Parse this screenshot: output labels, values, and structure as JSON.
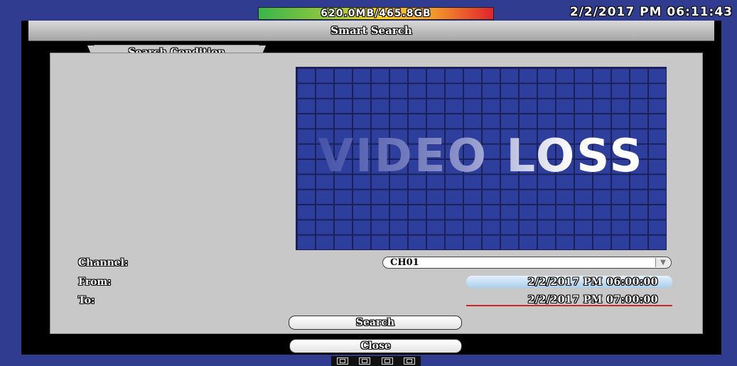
{
  "status_bar": {
    "storage": "620.0MB/465.8GB",
    "datetime": "2/2/2017 PM 06:11:43"
  },
  "window": {
    "title": "Smart Search",
    "tab_label": "Search Condition"
  },
  "preview": {
    "overlay_text": "VIDEO LOSS"
  },
  "form": {
    "channel_label": "Channel:",
    "channel_value": "CH01",
    "from_label": "From:",
    "from_value": "2/2/2017 PM 06:00:00",
    "to_label": "To:",
    "to_value": "2/2/2017 PM 07:00:00"
  },
  "buttons": {
    "search": "Search",
    "close": "Close"
  },
  "icons": {
    "dropdown": "chevron-down-icon",
    "bottom": [
      "camera-icon",
      "camera-icon",
      "camera-icon",
      "camera-icon"
    ]
  }
}
